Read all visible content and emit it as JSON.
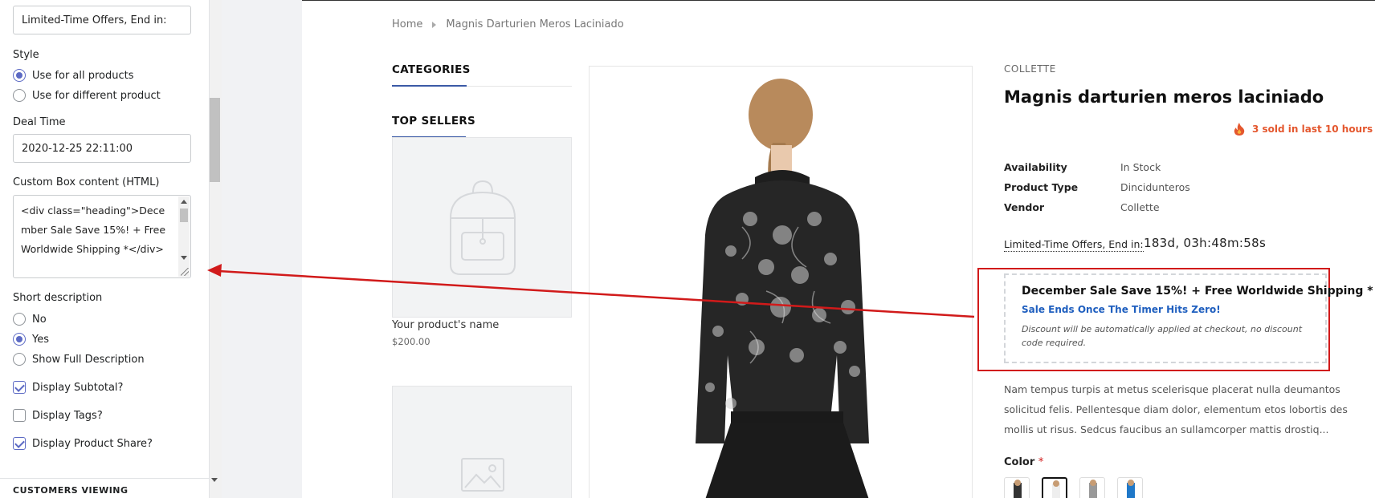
{
  "sidebar": {
    "countdown_text_value": "Limited-Time Offers, End in:",
    "style_label": "Style",
    "style_options": [
      "Use for all products",
      "Use for different product"
    ],
    "deal_time_label": "Deal Time",
    "deal_time_value": "2020-12-25 22:11:00",
    "custom_box_label": "Custom Box content (HTML)",
    "custom_box_value": "<div class=\"heading\">December Sale Save 15%! + Free Worldwide Shipping *</div>",
    "short_desc_label": "Short description",
    "short_desc_options": [
      "No",
      "Yes",
      "Show Full Description"
    ],
    "display_subtotal": "Display Subtotal?",
    "display_tags": "Display Tags?",
    "display_share": "Display Product Share?",
    "next_section": "CUSTOMERS VIEWING"
  },
  "preview": {
    "breadcrumb": [
      "Home",
      "Magnis Darturien Meros Laciniado"
    ],
    "categories_heading": "CATEGORIES",
    "top_sellers_heading": "TOP SELLERS",
    "placeholder_product_name": "Your product's name",
    "placeholder_product_price": "$200.00",
    "vendor_label": "COLLETTE",
    "product_title": "Magnis darturien meros laciniado",
    "sold_text": "3 sold in last 10 hours",
    "meta": [
      {
        "key": "Availability",
        "value": "In Stock"
      },
      {
        "key": "Product Type",
        "value": "Dincidunteros"
      },
      {
        "key": "Vendor",
        "value": "Collette"
      }
    ],
    "countdown_label": "Limited-Time Offers, End in:",
    "countdown_value": "183d, 03h:48m:58s",
    "promo_heading": "December Sale Save 15%! + Free Worldwide Shipping *",
    "promo_sub": "Sale Ends Once The Timer Hits Zero!",
    "promo_note": "Discount will be automatically applied at checkout, no discount code required.",
    "description": "Nam tempus turpis at metus scelerisque placerat nulla deumantos solicitud felis. Pellentesque diam dolor, elementum etos lobortis des mollis ut risus. Sedcus faucibus an sullamcorper mattis drostiq...",
    "color_label": "Color",
    "color_required": "*"
  },
  "colors": {
    "accent": "#5c6ac4",
    "highlight_border": "#d11a1a",
    "link_blue": "#1f5fbf",
    "sold_orange": "#e4572e"
  }
}
